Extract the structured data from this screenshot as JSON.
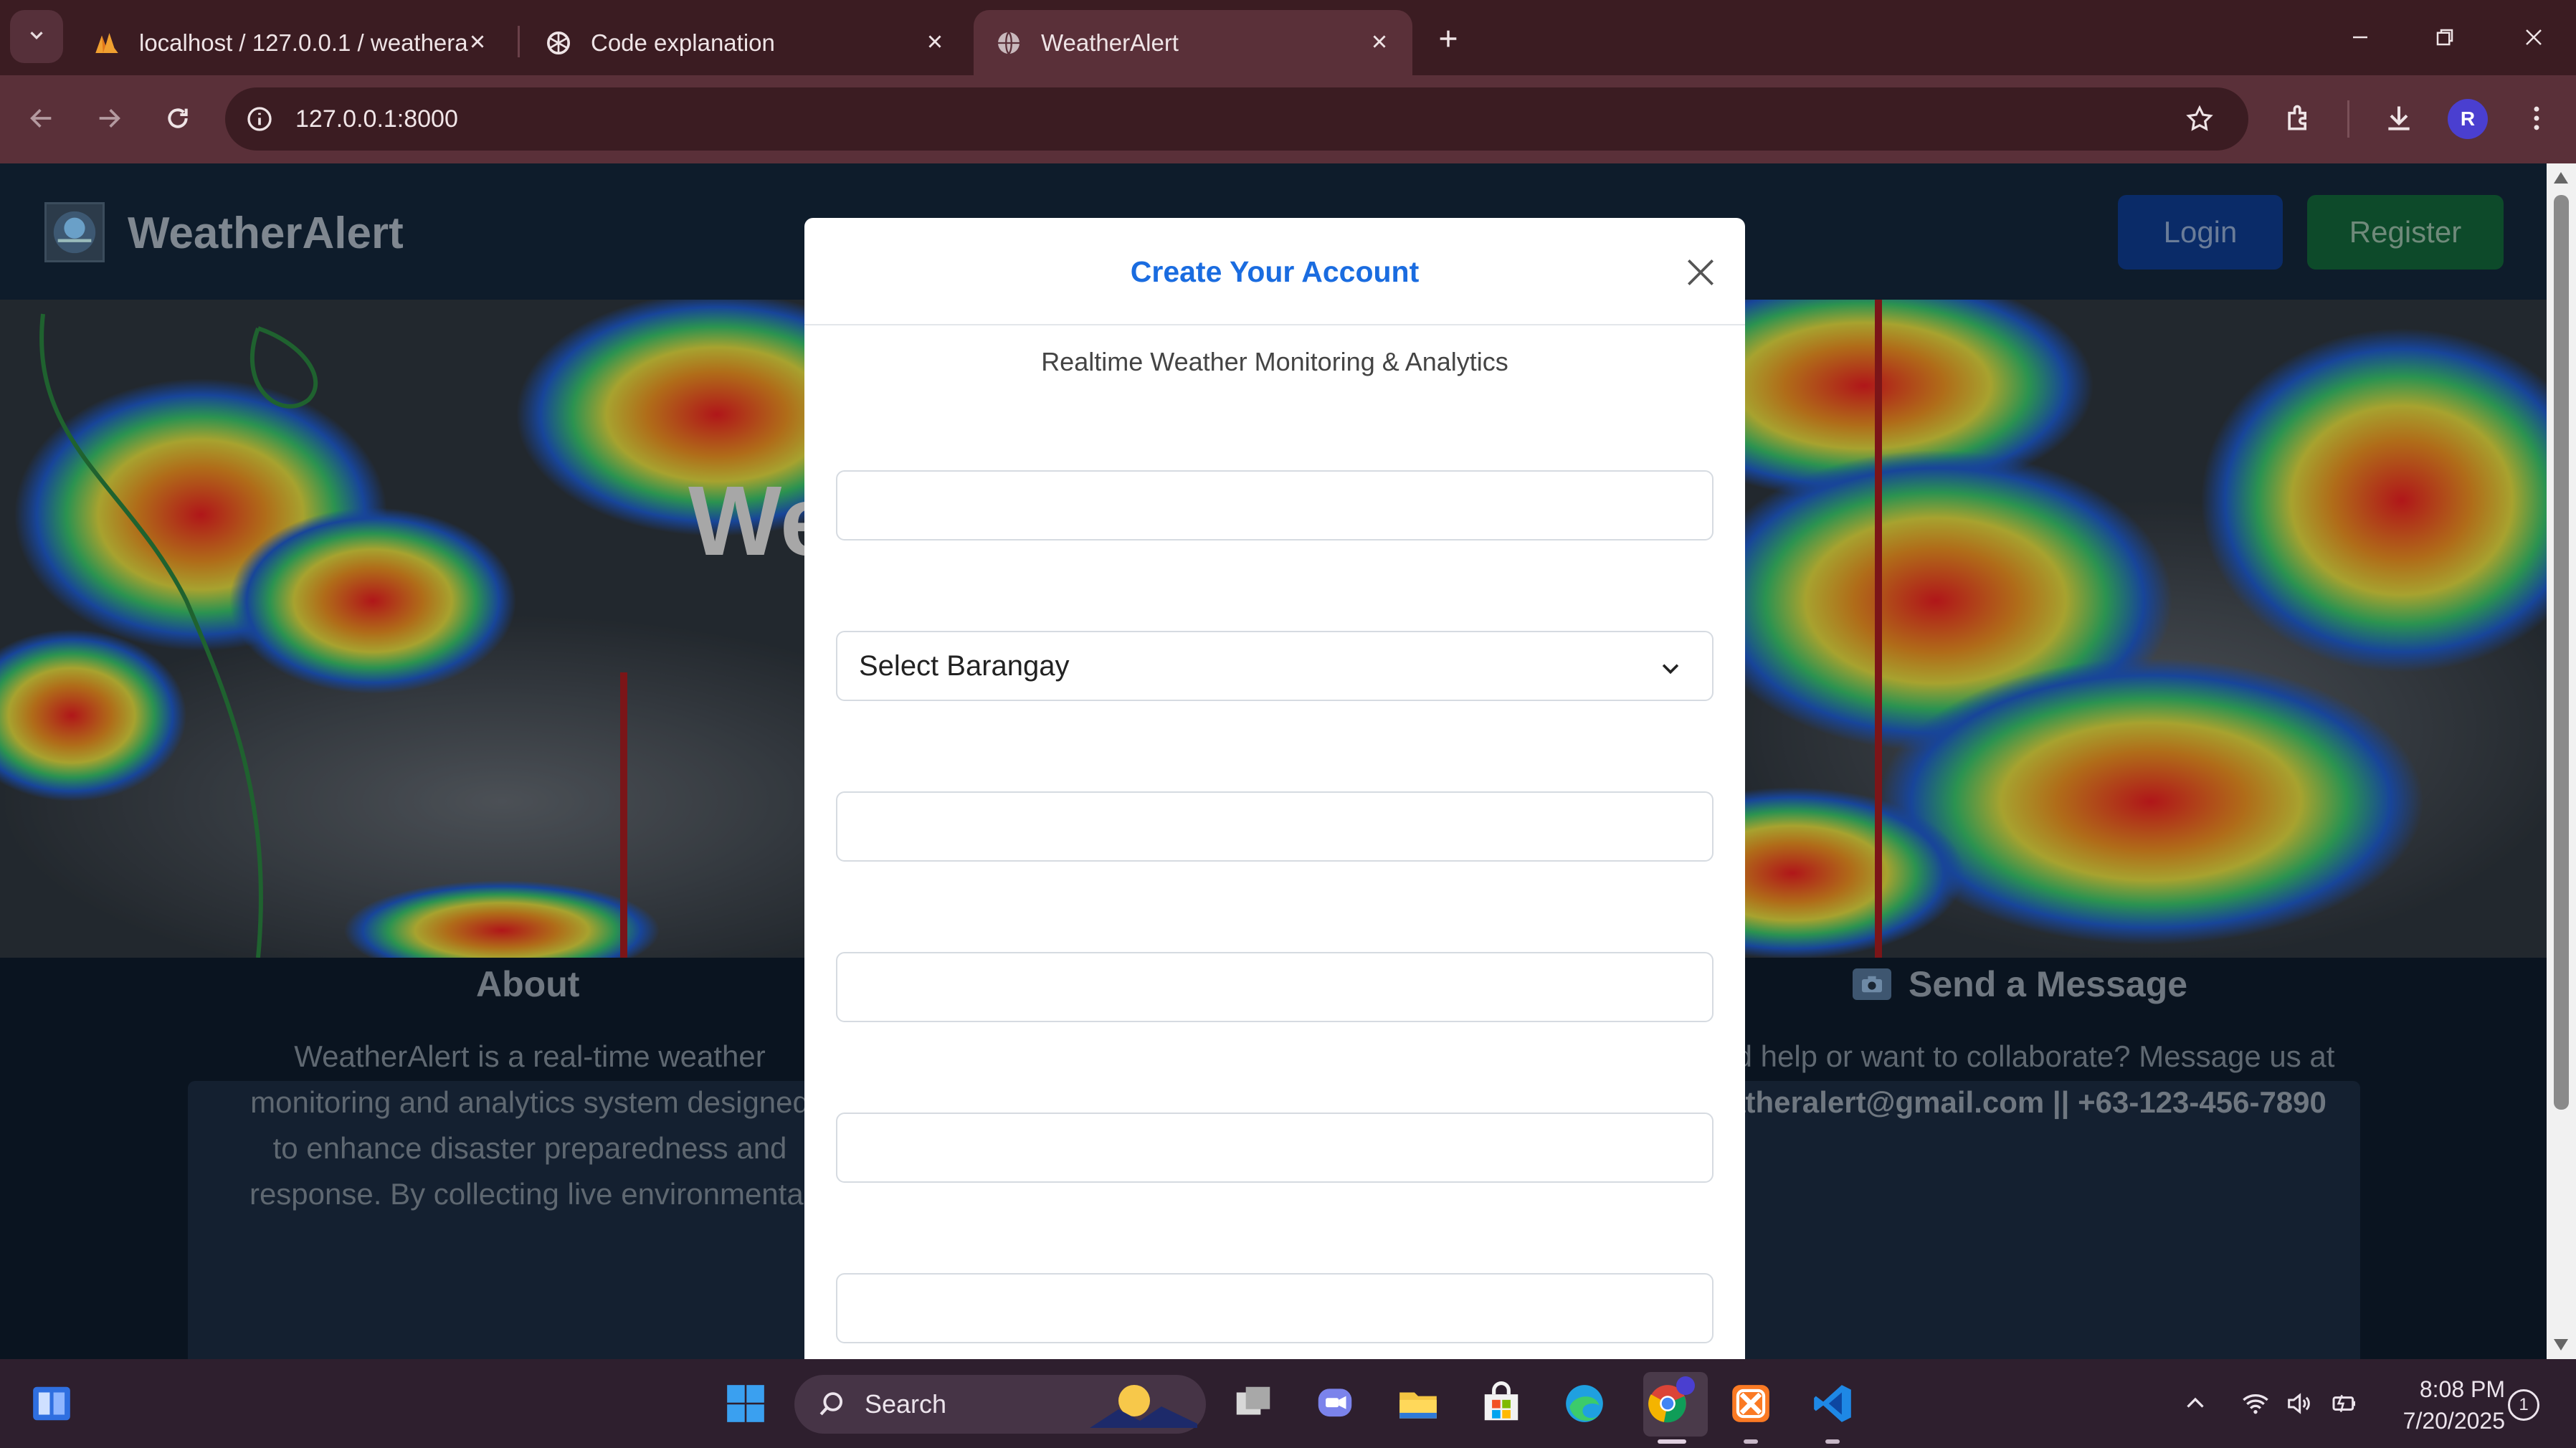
{
  "browser": {
    "tabs": [
      {
        "title": "localhost / 127.0.0.1 / weathera",
        "icon": "phpmyadmin-icon"
      },
      {
        "title": "Code explanation",
        "icon": "openai-icon"
      },
      {
        "title": "WeatherAlert",
        "icon": "globe-icon"
      }
    ],
    "active_tab": 2,
    "url": "127.0.0.1:8000",
    "profile_initial": "R"
  },
  "site": {
    "brand": "WeatherAlert",
    "login_label": "Login",
    "register_label": "Register",
    "hero_title": "WeatherAlert",
    "about": {
      "heading": "About",
      "text": "WeatherAlert is a real-time weather monitoring and analytics system designed to enhance disaster preparedness and response. By collecting live environmental"
    },
    "message": {
      "heading": "Send a Message",
      "text_prefix": "Need help or want to collaborate? Message us at",
      "email": "weatheralert@gmail.com",
      "separator": "||",
      "phone": "+63-123-456-7890"
    }
  },
  "modal": {
    "title": "Create Your Account",
    "subtitle": "Realtime Weather Monitoring & Analytics",
    "select_barangay": "Select Barangay",
    "fields": [
      "",
      "",
      "",
      "",
      ""
    ]
  },
  "taskbar": {
    "search_label": "Search",
    "time": "8:08 PM",
    "date": "7/20/2025",
    "notification_count": "1"
  },
  "colors": {
    "accent_blue": "#1a6ce0",
    "login_bg": "#0a2b68",
    "register_bg": "#0d4a2a",
    "chrome_bg": "#3b1c22"
  }
}
